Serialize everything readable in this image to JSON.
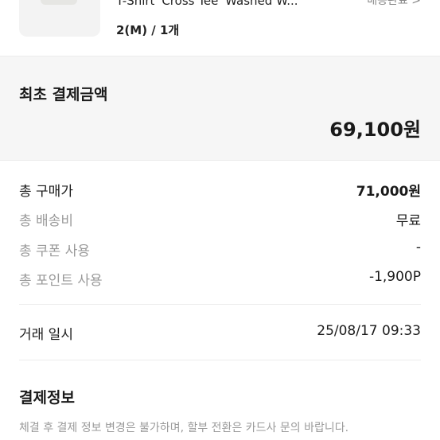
{
  "product": {
    "name": "T-Shirt 'Cross Tee' Washed W...",
    "option": "2(M) / 1개",
    "status_link": "배송완료 >"
  },
  "initial_payment": {
    "label": "최초 결제금액",
    "amount": "69,100원"
  },
  "breakdown": [
    {
      "label": "총 구매가",
      "value": "71,000원"
    },
    {
      "label": "총 배송비",
      "value": "무료"
    },
    {
      "label": "총 쿠폰 사용",
      "value": "-"
    },
    {
      "label": "총 포인트 사용",
      "value": "-1,900P"
    }
  ],
  "transaction": {
    "label": "거래 일시",
    "value": "25/08/17 09:33"
  },
  "payment_info": {
    "title": "결제정보",
    "notice": "체결 후 결제 정보 변경은 불가하며, 할부 전환은 카드사 문의 바랍니다."
  }
}
